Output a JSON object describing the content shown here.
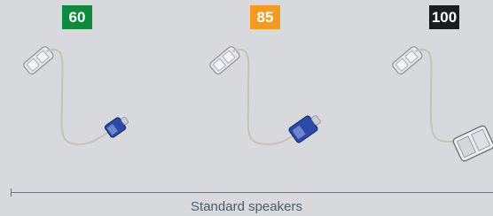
{
  "badges": [
    {
      "label": "60",
      "color": "#0e8a3d"
    },
    {
      "label": "85",
      "color": "#f29a22"
    },
    {
      "label": "100",
      "color": "#1b1c20"
    }
  ],
  "speakers": [
    {
      "size_label": "60",
      "receiver_color": "blue",
      "receiver_size": "small"
    },
    {
      "size_label": "85",
      "receiver_color": "blue",
      "receiver_size": "medium"
    },
    {
      "size_label": "100",
      "receiver_color": "clear",
      "receiver_size": "large"
    }
  ],
  "caption": "Standard speakers"
}
